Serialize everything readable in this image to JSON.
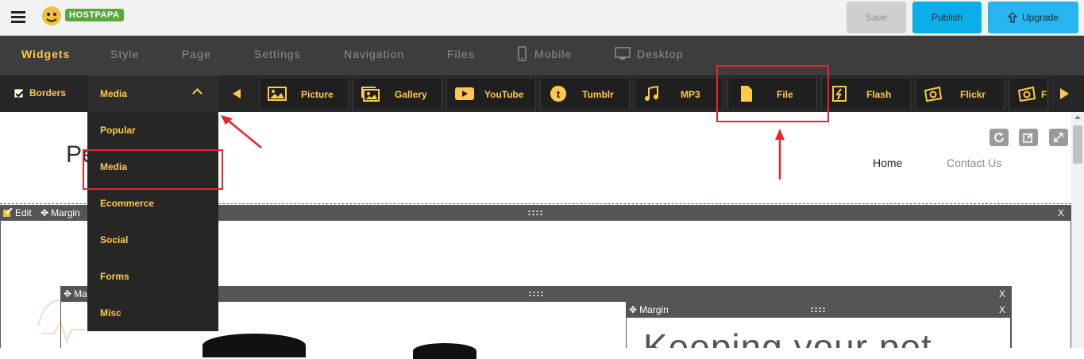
{
  "topbar": {
    "logo_text": "HOSTPAPA",
    "save_label": "Save",
    "publish_label": "Publish",
    "upgrade_label": "Upgrade"
  },
  "nav": {
    "tabs": [
      {
        "label": "Widgets",
        "active": true
      },
      {
        "label": "Style"
      },
      {
        "label": "Page"
      },
      {
        "label": "Settings"
      },
      {
        "label": "Navigation"
      },
      {
        "label": "Files"
      },
      {
        "label": "Mobile"
      },
      {
        "label": "Desktop"
      }
    ]
  },
  "widgetbar": {
    "borders_label": "Borders",
    "category_selected": "Media",
    "widgets": [
      {
        "label": "Picture",
        "icon": "picture-icon"
      },
      {
        "label": "Gallery",
        "icon": "gallery-icon"
      },
      {
        "label": "YouTube",
        "icon": "youtube-icon"
      },
      {
        "label": "Tumblr",
        "icon": "tumblr-icon"
      },
      {
        "label": "MP3",
        "icon": "music-note-icon"
      },
      {
        "label": "File",
        "icon": "file-icon"
      },
      {
        "label": "Flash",
        "icon": "flash-icon"
      },
      {
        "label": "Flickr",
        "icon": "flickr-icon"
      },
      {
        "label": "F",
        "icon": "camera-icon"
      }
    ]
  },
  "dropdown": {
    "items": [
      "Popular",
      "Media",
      "Ecommerce",
      "Social",
      "Forms",
      "Misc"
    ]
  },
  "site": {
    "title_partial": "Pe",
    "nav_home": "Home",
    "nav_contact": "Contact Us",
    "heading_partial": "Keeping your pet"
  },
  "editor": {
    "edit_label": "Edit",
    "margin_label": "Margin",
    "margin_label_short": "Ma",
    "close_label": "X"
  },
  "colors": {
    "accent": "#ffc94b",
    "annotation_red": "#e8232b",
    "publish_blue": "#0aaee9"
  }
}
